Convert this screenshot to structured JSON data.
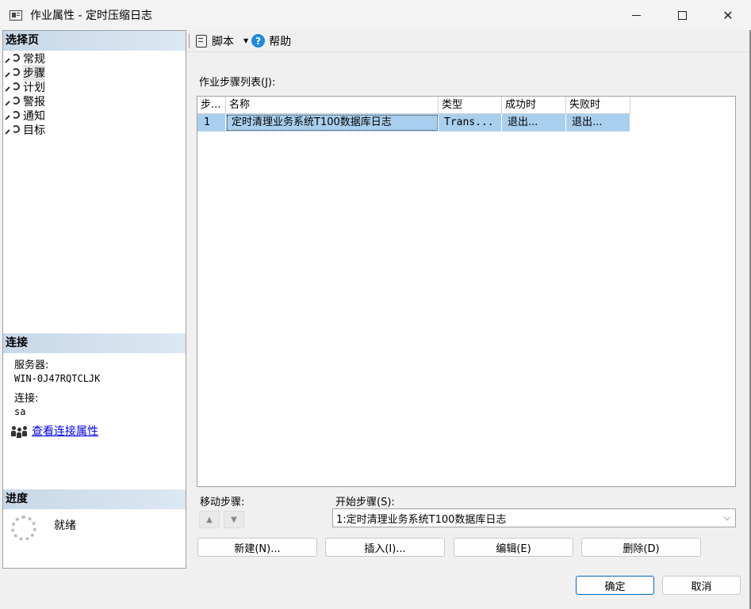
{
  "window": {
    "title": "作业属性 - 定时压缩日志",
    "minimize": "",
    "maximize": "",
    "close": "✕"
  },
  "sidebar": {
    "select_page_header": "选择页",
    "items": [
      {
        "label": "常规"
      },
      {
        "label": "步骤"
      },
      {
        "label": "计划"
      },
      {
        "label": "警报"
      },
      {
        "label": "通知"
      },
      {
        "label": "目标"
      }
    ],
    "selected_index": 1
  },
  "connection": {
    "header": "连接",
    "server_label": "服务器:",
    "server_value": "WIN-0J47RQTCLJK",
    "conn_label": "连接:",
    "conn_value": "sa",
    "view_link": "查看连接属性"
  },
  "progress": {
    "header": "进度",
    "status": "就绪"
  },
  "toolbar": {
    "script_label": "脚本",
    "script_arrow": "▼",
    "help_icon_glyph": "?",
    "help_label": "帮助"
  },
  "steps": {
    "list_label": "作业步骤列表(J):",
    "columns": [
      "步...",
      "名称",
      "类型",
      "成功时",
      "失败时"
    ],
    "rows": [
      {
        "step": "1",
        "name": "定时清理业务系统T100数据库日志",
        "type": "Trans...",
        "on_success": "退出...",
        "on_failure": "退出..."
      }
    ],
    "move_label": "移动步骤:",
    "move_up": "▲",
    "move_down": "▼",
    "start_label": "开始步骤(S):",
    "start_value": "1:定时清理业务系统T100数据库日志",
    "select_chevron": "⌵"
  },
  "buttons": {
    "new": "新建(N)...",
    "insert": "插入(I)...",
    "edit": "编辑(E)",
    "delete": "删除(D)",
    "ok": "确定",
    "cancel": "取消"
  },
  "colors": {
    "selection": "#a9cfee",
    "section_header": "#c8d8e8",
    "link": "#0000ee",
    "primary_border": "#0067c0"
  }
}
